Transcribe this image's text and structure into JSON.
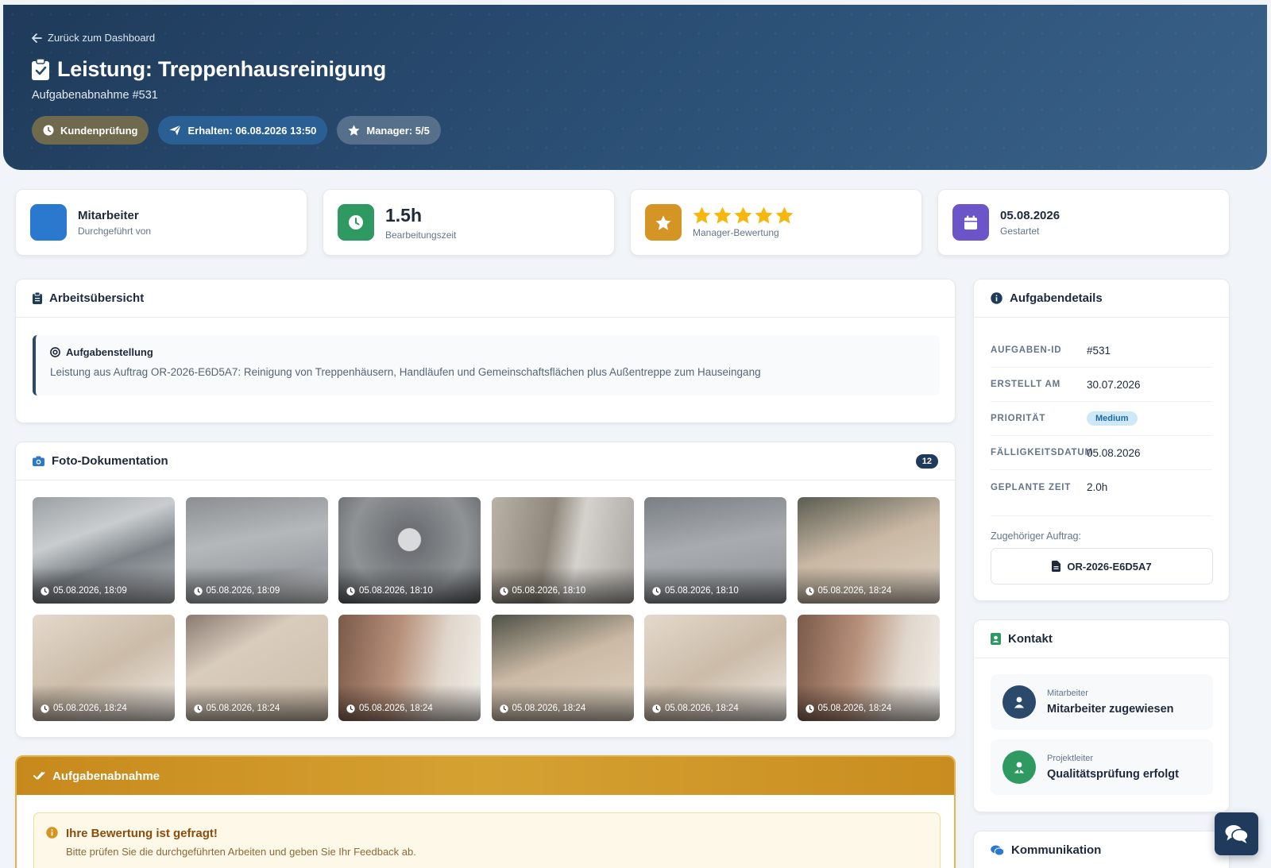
{
  "header": {
    "back_link": "Zurück zum Dashboard",
    "title": "Leistung: Treppenhausreinigung",
    "subtitle": "Aufgabenabnahme #531",
    "badges": [
      {
        "label": "Kundenprüfung",
        "icon": "clock-icon"
      },
      {
        "label": "Erhalten: 06.08.2026 13:50",
        "icon": "paper-plane-icon"
      },
      {
        "label": "Manager: 5/5",
        "icon": "star-icon"
      }
    ]
  },
  "stats": [
    {
      "main": "Mitarbeiter",
      "sub": "Durchgeführt von",
      "color": "#2b78cf"
    },
    {
      "main": "1.5h",
      "sub": "Bearbeitungszeit",
      "icon": "clock-icon",
      "color": "#2e9a62"
    },
    {
      "rating": 5,
      "sub": "Manager-Bewertung",
      "icon": "star-icon",
      "color": "#d49524"
    },
    {
      "main": "05.08.2026",
      "sub": "Gestartet",
      "icon": "calendar-icon",
      "color": "#6b55c8"
    }
  ],
  "overview": {
    "heading": "Arbeitsübersicht",
    "task_label": "Aufgabenstellung",
    "task_text": "Leistung aus Auftrag OR-2026-E6D5A7: Reinigung von Treppenhäusern, Handläufen und Gemeinschaftsflächen plus Außentreppe zum Hauseingang"
  },
  "photos": {
    "heading": "Foto-Dokumentation",
    "count": "12",
    "items": [
      "05.08.2026, 18:09",
      "05.08.2026, 18:09",
      "05.08.2026, 18:10",
      "05.08.2026, 18:10",
      "05.08.2026, 18:10",
      "05.08.2026, 18:24",
      "05.08.2026, 18:24",
      "05.08.2026, 18:24",
      "05.08.2026, 18:24",
      "05.08.2026, 18:24",
      "05.08.2026, 18:24",
      "05.08.2026, 18:24"
    ]
  },
  "acceptance": {
    "heading": "Aufgabenabnahme",
    "alert_title": "Ihre Bewertung ist gefragt!",
    "alert_text": "Bitte prüfen Sie die durchgeführten Arbeiten und geben Sie Ihr Feedback ab."
  },
  "details": {
    "heading": "Aufgabendetails",
    "rows": [
      {
        "label": "AUFGABEN-ID",
        "value": "#531"
      },
      {
        "label": "ERSTELLT AM",
        "value": "30.07.2026"
      },
      {
        "label": "PRIORITÄT",
        "value": "Medium"
      },
      {
        "label": "FÄLLIGKEITSDATUM",
        "value": "05.08.2026"
      },
      {
        "label": "GEPLANTE ZEIT",
        "value": "2.0h"
      }
    ],
    "assoc_label": "Zugehöriger Auftrag:",
    "assoc_value": "OR-2026-E6D5A7"
  },
  "contact": {
    "heading": "Kontakt",
    "people": [
      {
        "role": "Mitarbeiter",
        "name": "Mitarbeiter zugewiesen",
        "color": "#2b4a6b"
      },
      {
        "role": "Projektleiter",
        "name": "Qualitätsprüfung erfolgt",
        "color": "#2e9a62"
      }
    ]
  },
  "communication": {
    "heading": "Kommunikation"
  }
}
